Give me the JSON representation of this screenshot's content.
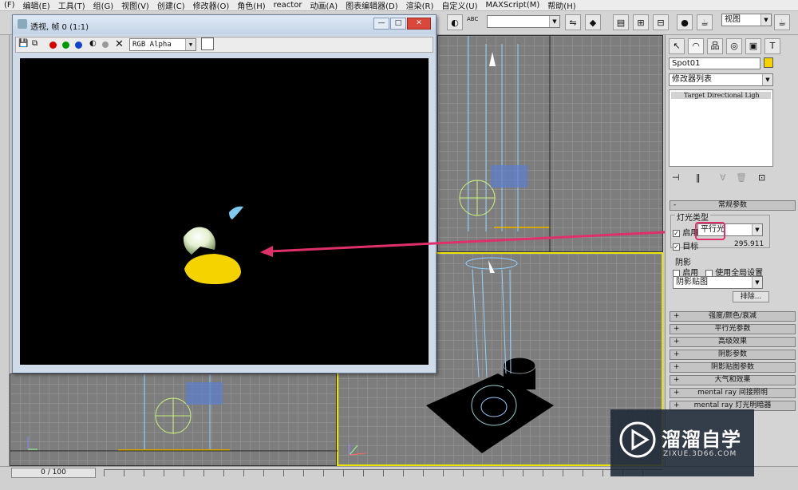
{
  "menu": [
    "(F)",
    "编辑(E)",
    "工具(T)",
    "组(G)",
    "视图(V)",
    "创建(C)",
    "修改器(O)",
    "角色(H)",
    "reactor",
    "动画(A)",
    "图表编辑器(D)",
    "渲染(R)",
    "自定义(U)",
    "MAXScript(M)",
    "帮助(H)"
  ],
  "toolbar": {
    "view_combo": "视图",
    "abc_label": "ABC"
  },
  "render_window": {
    "title": "透视, 帧 0 (1:1)",
    "channel_select": "RGB Alpha",
    "close_glyph": "✕"
  },
  "command_panel": {
    "object_name": "Spot01",
    "modifier_list": "修改器列表",
    "stack_item": "Target Directional Ligh",
    "general_params": {
      "header": "常规参数",
      "light_type_label": "灯光类型",
      "enable_label": "启用",
      "light_type_value": "平行光",
      "target_label": "目标",
      "target_distance": "295.911",
      "shadows_label": "阴影",
      "shadow_enable_label": "启用",
      "global_settings_label": "使用全局设置",
      "shadow_type": "阴影贴图",
      "exclude_button": "排除..."
    },
    "rollouts": [
      "强度/颜色/衰减",
      "平行光参数",
      "高级效果",
      "阴影参数",
      "阴影贴图参数",
      "大气和效果",
      "mental ray 间接照明",
      "mental ray 灯光明暗器"
    ]
  },
  "timeline": {
    "frame_counter": "0 / 100"
  },
  "watermark": {
    "brand": "溜溜自学",
    "url": "ZIXUE.3D66.COM"
  },
  "colors": {
    "highlight": "#e0306a",
    "active_viewport": "#e9e400",
    "light_yellow": "#f5d300"
  }
}
